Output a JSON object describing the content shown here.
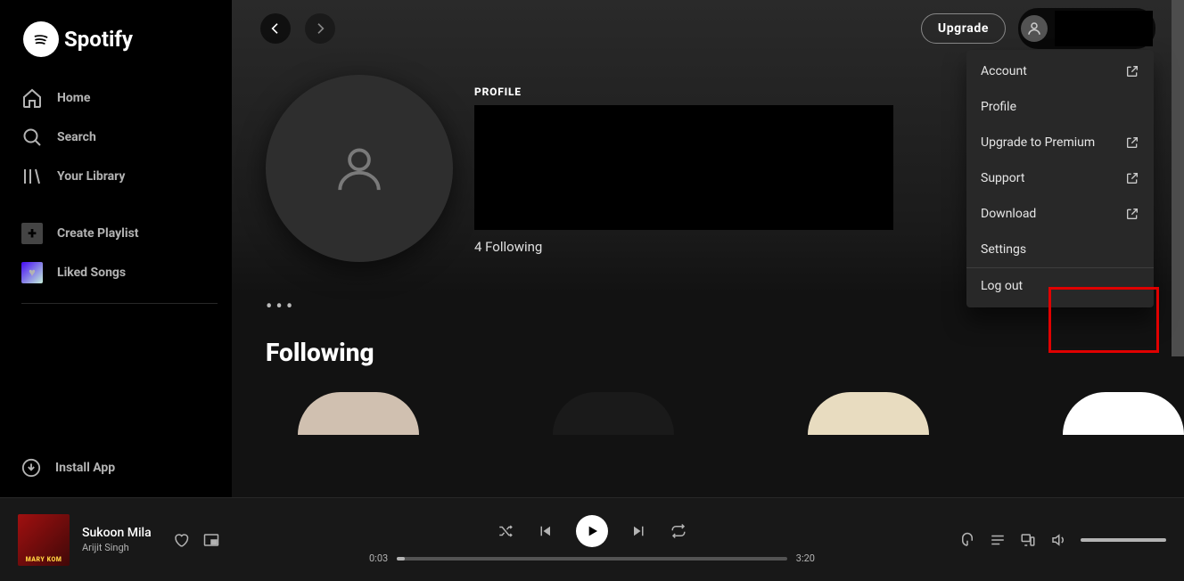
{
  "brand": "Spotify",
  "sidebar": {
    "items": [
      {
        "label": "Home"
      },
      {
        "label": "Search"
      },
      {
        "label": "Your Library"
      }
    ],
    "create": "Create Playlist",
    "liked": "Liked Songs",
    "install": "Install App"
  },
  "topbar": {
    "upgrade": "Upgrade"
  },
  "profile": {
    "label": "PROFILE",
    "following": "4 Following",
    "section_title": "Following"
  },
  "dropdown": {
    "account": "Account",
    "profile": "Profile",
    "upgrade": "Upgrade to Premium",
    "support": "Support",
    "download": "Download",
    "settings": "Settings",
    "logout": "Log out"
  },
  "player": {
    "track": "Sukoon Mila",
    "artist": "Arijit Singh",
    "art_caption": "MARY KOM",
    "elapsed": "0:03",
    "duration": "3:20"
  }
}
